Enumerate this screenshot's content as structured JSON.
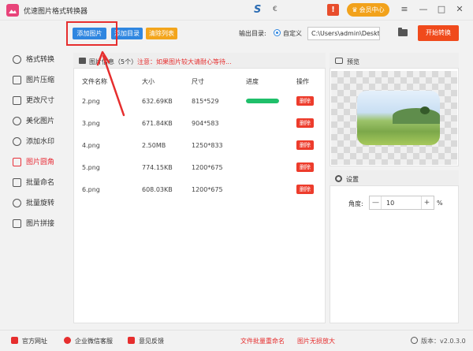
{
  "app": {
    "title": "优速图片格式转换器",
    "brand_s": "S",
    "brand_e": "€"
  },
  "titlebar": {
    "vip_label": "会员中心",
    "gift_glyph": "!",
    "menu_glyph": "≡",
    "min_glyph": "—",
    "max_glyph": "□",
    "close_glyph": "✕"
  },
  "toolbar": {
    "add_image": "添加图片",
    "add_folder": "添加目录",
    "clear_list": "清除列表",
    "output_label": "输出目录:",
    "radio_custom": "自定义",
    "path_value": "C:\\Users\\admin\\Deskto",
    "start_button": "开始转换"
  },
  "sidebar": {
    "items": [
      {
        "label": "格式转换",
        "icon": "refresh-icon"
      },
      {
        "label": "图片压缩",
        "icon": "compress-icon"
      },
      {
        "label": "更改尺寸",
        "icon": "resize-icon"
      },
      {
        "label": "美化图片",
        "icon": "beautify-icon"
      },
      {
        "label": "添加水印",
        "icon": "watermark-icon"
      },
      {
        "label": "图片圆角",
        "icon": "rounded-corner-icon",
        "active": true
      },
      {
        "label": "批量命名",
        "icon": "rename-icon"
      },
      {
        "label": "批量旋转",
        "icon": "rotate-icon"
      },
      {
        "label": "图片拼接",
        "icon": "stitch-icon"
      }
    ]
  },
  "list": {
    "info_label": "图片信息（5个）",
    "warning": "注意：如果图片较大请耐心等待...",
    "columns": {
      "name": "文件名称",
      "size": "大小",
      "dims": "尺寸",
      "progress": "进度",
      "action": "操作"
    },
    "delete_label": "删除",
    "rows": [
      {
        "name": "2.png",
        "size": "632.69KB",
        "dims": "815*529",
        "progress": 1.0
      },
      {
        "name": "3.png",
        "size": "671.84KB",
        "dims": "904*583",
        "progress": 0
      },
      {
        "name": "4.png",
        "size": "2.50MB",
        "dims": "1250*833",
        "progress": 0
      },
      {
        "name": "5.png",
        "size": "774.15KB",
        "dims": "1200*675",
        "progress": 0
      },
      {
        "name": "6.png",
        "size": "608.03KB",
        "dims": "1200*675",
        "progress": 0
      }
    ]
  },
  "preview": {
    "label": "预览"
  },
  "settings": {
    "label": "设置",
    "angle_label": "角度:",
    "angle_value": "10",
    "unit": "%",
    "minus": "—",
    "plus": "+"
  },
  "footer": {
    "website": "官方网址",
    "wechat": "企业微信客服",
    "feedback": "意见反馈",
    "batch_rename": "文件批量重命名",
    "lossless_zoom": "图片无损放大",
    "version": "版本：v2.0.3.0"
  },
  "colors": {
    "accent": "#2f86e0",
    "start": "#f04a1c",
    "active": "#e8303a",
    "progress": "#1fbf6a",
    "vip": "#f2a21b"
  }
}
